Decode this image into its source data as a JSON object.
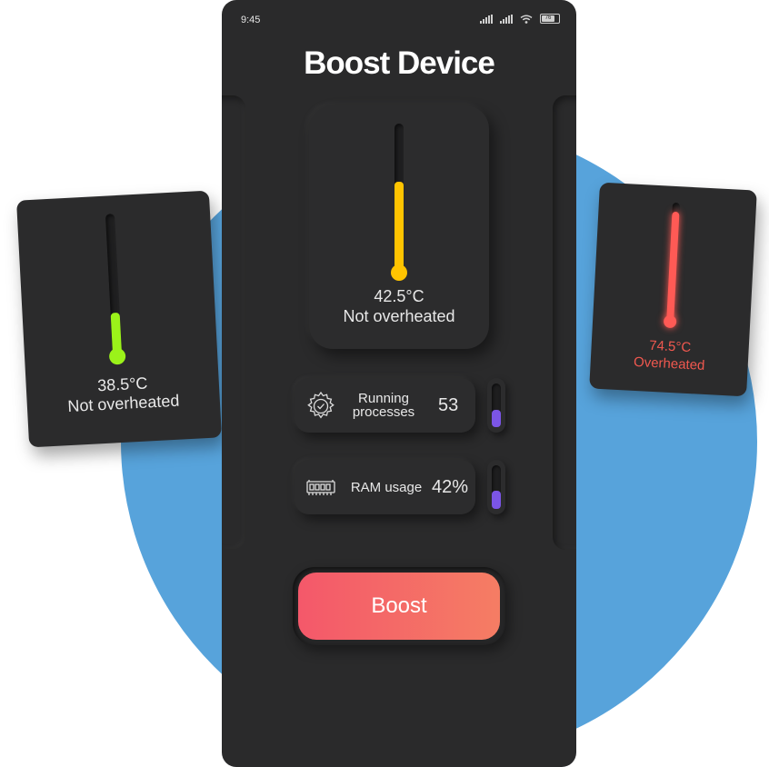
{
  "status_bar": {
    "time": "9:45",
    "battery": "76"
  },
  "header": {
    "title": "Boost Device"
  },
  "main_gauge": {
    "temperature": "42.5°C",
    "status": "Not overheated",
    "level": 0.6,
    "color": "#ffc400"
  },
  "left_card": {
    "temperature": "38.5°C",
    "status": "Not overheated",
    "level": 0.3,
    "color": "#9bf21a"
  },
  "right_card": {
    "temperature": "74.5°C",
    "status": "Overheated",
    "level": 0.92,
    "color": "#ff5a55"
  },
  "processes": {
    "label_line1": "Running",
    "label_line2": "processes",
    "value": "53",
    "icon": "gear-check-icon",
    "level": 0.4
  },
  "ram": {
    "label": "RAM usage",
    "value": "42%",
    "icon": "ram-chip-icon",
    "level": 0.42
  },
  "boost_button": {
    "label": "Boost"
  },
  "colors": {
    "accent_purple": "#7b55e6",
    "background_blue": "#57a3db",
    "boost_gradient_start": "#f4586a",
    "boost_gradient_end": "#f57d64"
  }
}
